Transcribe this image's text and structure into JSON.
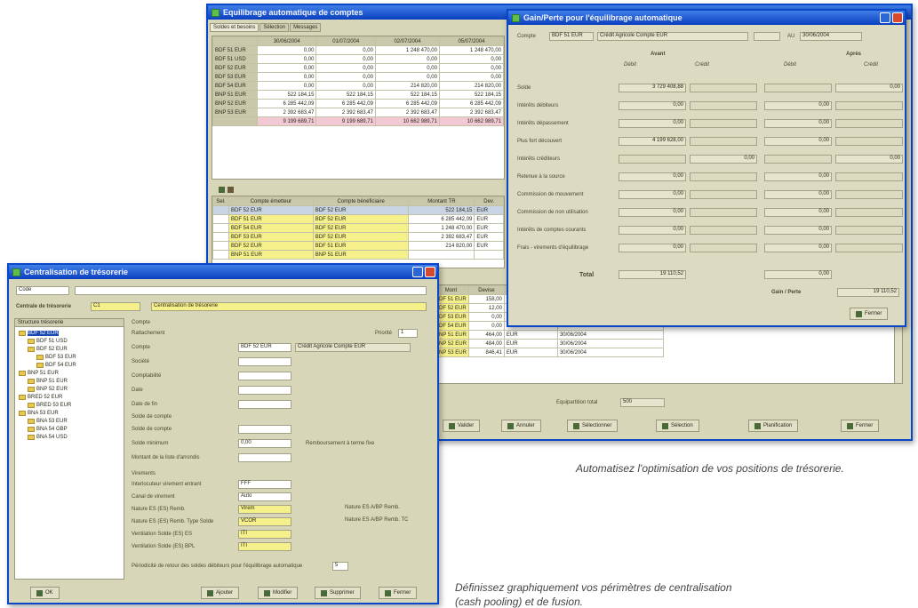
{
  "window1": {
    "title": "Equilibrage automatique de comptes",
    "tabs": [
      "Soldes et besoins",
      "Sélection",
      "Messages"
    ],
    "grid": {
      "headers": [
        "",
        "30/06/2004",
        "01/07/2004",
        "02/07/2004",
        "05/07/2004"
      ],
      "rows": [
        [
          "BDF 51 EUR",
          "0,00",
          "0,00",
          "1 248 470,00",
          "1 248 470,00"
        ],
        [
          "BDF 51 USD",
          "0,00",
          "0,00",
          "0,00",
          "0,00"
        ],
        [
          "BDF 52 EUR",
          "0,00",
          "0,00",
          "0,00",
          "0,00"
        ],
        [
          "BDF 53 EUR",
          "0,00",
          "0,00",
          "0,00",
          "0,00"
        ],
        [
          "BDF 54 EUR",
          "0,00",
          "0,00",
          "214 820,00",
          "214 820,00"
        ],
        [
          "BNP 51 EUR",
          "522 184,15",
          "522 184,15",
          "522 184,15",
          "522 184,15"
        ],
        [
          "BNP 52 EUR",
          "6 285 442,09",
          "6 285 442,09",
          "6 285 442,09",
          "6 285 442,09"
        ],
        [
          "BNP 53 EUR",
          "2 392 683,47",
          "2 392 683,47",
          "2 392 683,47",
          "2 392 683,47"
        ]
      ],
      "total": [
        "",
        "9 199 689,71",
        "9 199 689,71",
        "10 662 989,71",
        "10 662 989,71"
      ]
    },
    "list": {
      "headers": [
        "Sel.",
        "Compte émetteur",
        "Compte bénéficiaire",
        "Montant TR",
        "Dev."
      ],
      "rows": [
        [
          "",
          "BDF 52 EUR",
          "BDF 52 EUR",
          "522 184,15",
          "EUR"
        ],
        [
          "",
          "BDF 51 EUR",
          "BDF 52 EUR",
          "6 285 442,09",
          "EUR"
        ],
        [
          "",
          "BDF 54 EUR",
          "BDF 52 EUR",
          "1 248 470,00",
          "EUR"
        ],
        [
          "",
          "BDF 53 EUR",
          "BDF 52 EUR",
          "2 392 683,47",
          "EUR"
        ],
        [
          "",
          "BDF 52 EUR",
          "BDF 51 EUR",
          "214 820,00",
          "EUR"
        ],
        [
          "",
          "BNP 51 EUR",
          "BNP 51 EUR",
          "",
          ""
        ]
      ]
    },
    "lower_list": {
      "headers": [
        "Mont",
        "Devise"
      ],
      "rows": [
        [
          "BDF 51 EUR",
          "158,00",
          "EUR",
          "30/06/2004"
        ],
        [
          "BDF 52 EUR",
          "12,00",
          "EUR",
          "30/06/2004"
        ],
        [
          "BDF 53 EUR",
          "0,00",
          "EUR",
          "30/06/2004"
        ],
        [
          "BDF 54 EUR",
          "0,00",
          "EUR",
          "30/06/2004"
        ],
        [
          "BNP 51 EUR",
          "464,00",
          "EUR",
          "30/06/2004"
        ],
        [
          "BNP 52 EUR",
          "484,00",
          "EUR",
          "30/06/2004"
        ],
        [
          "BNP 53 EUR",
          "846,41",
          "EUR",
          "30/06/2004"
        ]
      ]
    },
    "equipartition_label": "Equipartition total",
    "equipartition_value": "500",
    "buttons": [
      "Valider",
      "Annuler",
      "Sélectionner",
      "Sélection",
      "Planification",
      "Fermer"
    ]
  },
  "window2": {
    "title": "Gain/Perte pour l'équilibrage automatique",
    "compte_label": "Compte",
    "compte_value": "BDF 51 EUR",
    "compte_desc": "Crédit Agricole Compte EUR",
    "au_label": "AU",
    "au_value": "30/06/2004",
    "avant_label": "Avant",
    "apres_label": "Après",
    "debit_label": "Débit",
    "credit_label": "Crédit",
    "rows": [
      {
        "label": "Solde",
        "avant_debit": "3 729 408,88",
        "avant_credit": "",
        "apres_debit": "",
        "apres_credit": "0,00"
      },
      {
        "label": "Intérêts débiteurs",
        "avant_debit": "0,00",
        "avant_credit": "",
        "apres_debit": "0,00",
        "apres_credit": ""
      },
      {
        "label": "Intérêts dépassement",
        "avant_debit": "0,00",
        "avant_credit": "",
        "apres_debit": "0,00",
        "apres_credit": ""
      },
      {
        "label": "Plus fort découvert",
        "avant_debit": "4 199 628,00",
        "avant_credit": "",
        "apres_debit": "0,00",
        "apres_credit": ""
      },
      {
        "label": "Intérêts créditeurs",
        "avant_debit": "",
        "avant_credit": "0,00",
        "apres_debit": "",
        "apres_credit": "0,00"
      },
      {
        "label": "Retenue à la source",
        "avant_debit": "0,00",
        "avant_credit": "",
        "apres_debit": "0,00",
        "apres_credit": ""
      },
      {
        "label": "Commission de mouvement",
        "avant_debit": "0,00",
        "avant_credit": "",
        "apres_debit": "0,00",
        "apres_credit": ""
      },
      {
        "label": "Commission de non utilisation",
        "avant_debit": "0,00",
        "avant_credit": "",
        "apres_debit": "0,00",
        "apres_credit": ""
      },
      {
        "label": "Intérêts de comptes courants",
        "avant_debit": "0,00",
        "avant_credit": "",
        "apres_debit": "0,00",
        "apres_credit": ""
      },
      {
        "label": "Frais - virements d'équilibrage",
        "avant_debit": "0,00",
        "avant_credit": "",
        "apres_debit": "0,00",
        "apres_credit": ""
      }
    ],
    "total_label": "Total",
    "total_avant": "19 110,52",
    "total_apres": "0,00",
    "gain_label": "Gain / Perte",
    "gain_value": "19 110,52",
    "close_button": "Fermer"
  },
  "window3": {
    "title": "Centralisation de trésorerie",
    "filter_value": "Code",
    "centralisation_label": "Centrale de trésorerie",
    "centralisation_code": "C1",
    "centralisation_name": "Centralisation de trésorerie",
    "tree_tab": "Structure trésorerie",
    "tree": [
      {
        "label": "BDF 52 EUR",
        "level": 0,
        "selected": true
      },
      {
        "label": "BDF 51 USD",
        "level": 1
      },
      {
        "label": "BDF 52 EUR",
        "level": 1
      },
      {
        "label": "BDF 53 EUR",
        "level": 2
      },
      {
        "label": "BDF 54 EUR",
        "level": 2
      },
      {
        "label": "BNP 51 EUR",
        "level": 0
      },
      {
        "label": "BNP 51 EUR",
        "level": 1
      },
      {
        "label": "BNP 52 EUR",
        "level": 1
      },
      {
        "label": "BRED 52 EUR",
        "level": 0
      },
      {
        "label": "BRED 53 EUR",
        "level": 1
      },
      {
        "label": "BNA 53 EUR",
        "level": 0
      },
      {
        "label": "BNA 53 EUR",
        "level": 1
      },
      {
        "label": "BNA 54 GBP",
        "level": 1
      },
      {
        "label": "BNA 54 USD",
        "level": 1
      }
    ],
    "section_compte": "Compte",
    "section_rattache": "Rattachement",
    "priority_label": "Priorité",
    "priority_value": "1",
    "form_labels": [
      "Compte",
      "Société",
      "Comptabilité",
      "Date",
      "Date de fin"
    ],
    "form_values": [
      "BDF 52 EUR",
      "",
      "",
      "",
      ""
    ],
    "compte_desc": "Crédit Agricole Compte EUR",
    "section_solde": "Solde de compte",
    "solde_fields": [
      "Solde de compte",
      "Solde minimum",
      "Montant de la liste d'arrondis"
    ],
    "solde_values": [
      "",
      "0,00",
      ""
    ],
    "section_virement": "Virements",
    "virement_fields": [
      "Interlocuteur virement entrant",
      "Canal de virement",
      "Nature ES (ES) Remb.",
      "Nature ES (ES) Remb. Type Solde",
      "Ventilation Solde (ES) ES",
      "Ventilation Solde (ES) BPL"
    ],
    "virement_values": [
      "FFF",
      "Auto",
      "Virem",
      "VCOR",
      "ITI",
      "ITI"
    ],
    "nature_right": [
      "Nature ES A/BP Remb.",
      "Nature ES A/BP Remb. TC"
    ],
    "checkbox_label": "Remboursement à terme fixe",
    "note": "Périodicité de retour des soldes débiteurs pour l'équilibrage automatique",
    "note_value": "5",
    "buttons": [
      "OK",
      "Ajouter",
      "Modifier",
      "Supprimer",
      "Fermer"
    ]
  },
  "caption1": "Automatisez l'optimisation de vos positions de trésorerie.",
  "caption2_line1": "Définissez graphiquement vos périmètres de centralisation",
  "caption2_line2": "(cash pooling) et de fusion."
}
